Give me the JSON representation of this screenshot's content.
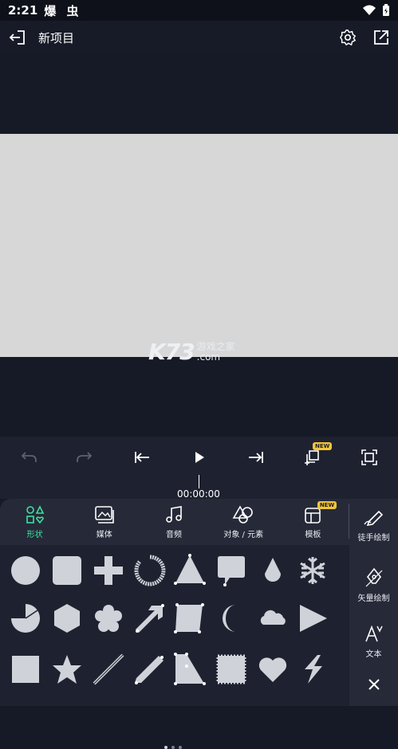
{
  "status": {
    "time": "2:21",
    "extra": "爆 虫"
  },
  "topbar": {
    "title": "新项目"
  },
  "watermark": {
    "big": "K73",
    "line1": "游戏之家",
    "line2": ".com"
  },
  "timeline": {
    "timecode": "00:00:00"
  },
  "categories": [
    {
      "label": "形状",
      "active": true
    },
    {
      "label": "媒体"
    },
    {
      "label": "音频"
    },
    {
      "label": "对象 / 元素"
    },
    {
      "label": "模板",
      "badge": "NEW"
    }
  ],
  "add_badge": "NEW",
  "side": [
    {
      "label": "徒手绘制"
    },
    {
      "label": "矢量绘制"
    },
    {
      "label": "文本"
    }
  ],
  "shapes": [
    "circle",
    "rounded-square",
    "plus",
    "ring",
    "triangle",
    "speech-bubble",
    "drop",
    "snowflake",
    "pie",
    "hexagon",
    "flower",
    "arrow",
    "quad",
    "crescent",
    "cloud",
    "play-triangle",
    "square",
    "star",
    "line",
    "pencil-line",
    "l-shape",
    "stamp",
    "heart",
    "lightning"
  ],
  "colors": {
    "accent": "#3ee0a0",
    "badge": "#f3c53a",
    "shape": "#cfd2d8"
  }
}
